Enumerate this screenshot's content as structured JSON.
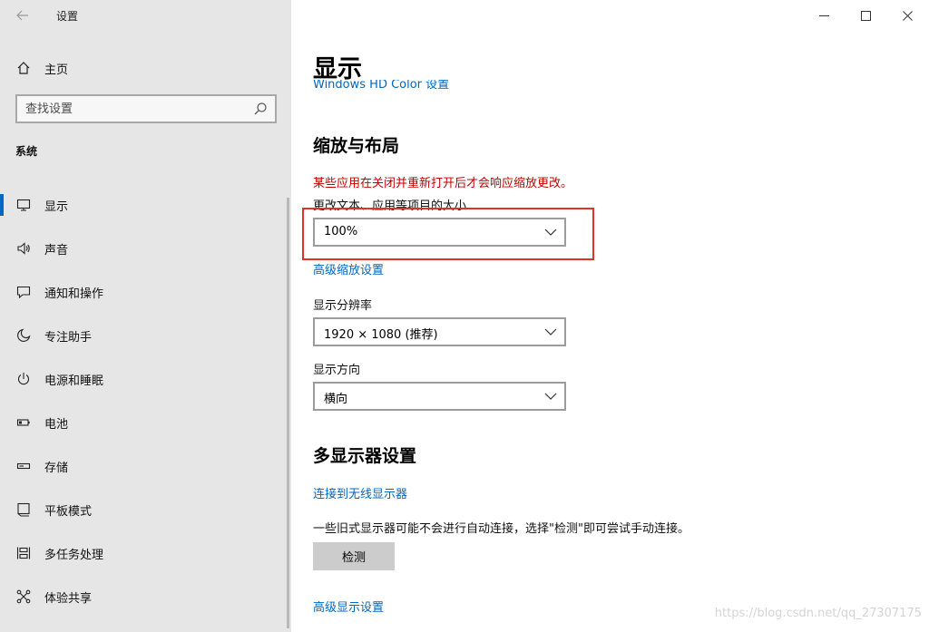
{
  "window": {
    "title": "设置",
    "back_icon": "arrow-left-icon",
    "controls": [
      "minimize",
      "maximize",
      "close"
    ]
  },
  "sidebar": {
    "home": {
      "label": "主页",
      "icon": "home-icon"
    },
    "search": {
      "placeholder": "查找设置",
      "icon": "search-icon"
    },
    "section_label": "系统",
    "items": [
      {
        "label": "显示",
        "icon": "monitor-icon",
        "active": true
      },
      {
        "label": "声音",
        "icon": "speaker-icon"
      },
      {
        "label": "通知和操作",
        "icon": "message-icon"
      },
      {
        "label": "专注助手",
        "icon": "moon-icon"
      },
      {
        "label": "电源和睡眠",
        "icon": "power-icon"
      },
      {
        "label": "电池",
        "icon": "battery-icon"
      },
      {
        "label": "存储",
        "icon": "storage-icon"
      },
      {
        "label": "平板模式",
        "icon": "tablet-icon"
      },
      {
        "label": "多任务处理",
        "icon": "multitask-icon"
      },
      {
        "label": "体验共享",
        "icon": "share-icon"
      }
    ]
  },
  "main": {
    "title": "显示",
    "partial_link": "Windows HD Color 设置",
    "scale_layout": {
      "heading": "缩放与布局",
      "warning": "某些应用在关闭并重新打开后才会响应缩放更改。",
      "scale_label": "更改文本、应用等项目的大小",
      "scale_value": "100%",
      "advanced_scale_link": "高级缩放设置",
      "resolution_label": "显示分辨率",
      "resolution_value": "1920 × 1080 (推荐)",
      "orientation_label": "显示方向",
      "orientation_value": "横向"
    },
    "multi_display": {
      "heading": "多显示器设置",
      "wireless_link": "连接到无线显示器",
      "info_text": "一些旧式显示器可能不会进行自动连接，选择\"检测\"即可尝试手动连接。",
      "detect_button": "检测",
      "advanced_display_link": "高级显示设置"
    }
  },
  "watermark": "https://blog.csdn.net/qq_27307175",
  "colors": {
    "accent": "#0067c0",
    "warning": "#c40000",
    "highlight_box": "#e03030",
    "sidebar_bg": "#e6e6e6"
  }
}
